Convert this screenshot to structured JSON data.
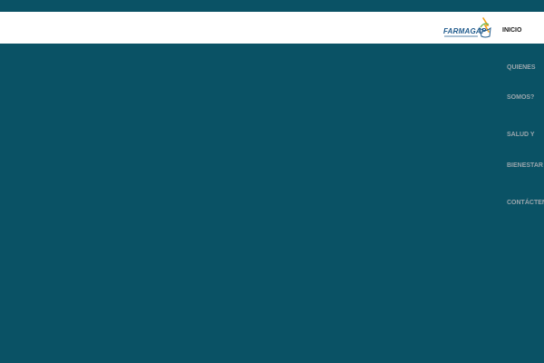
{
  "brand": {
    "logo_text": "FARMAGAP",
    "logo_icon": "mortar-pestle-leaf-icon",
    "colors": {
      "background": "#0a5265",
      "header": "#ffffff",
      "logo_blue": "#1f5a8c",
      "logo_orange": "#f2a21b",
      "logo_green": "#5fb046"
    }
  },
  "nav": {
    "items": [
      {
        "label": "INICIO",
        "active": true
      },
      {
        "label": "QUIENES"
      },
      {
        "label": "SOMOS?"
      },
      {
        "label": "SALUD Y"
      },
      {
        "label": "BIENESTAR"
      },
      {
        "label": "CONTÁCTENOS"
      }
    ]
  }
}
